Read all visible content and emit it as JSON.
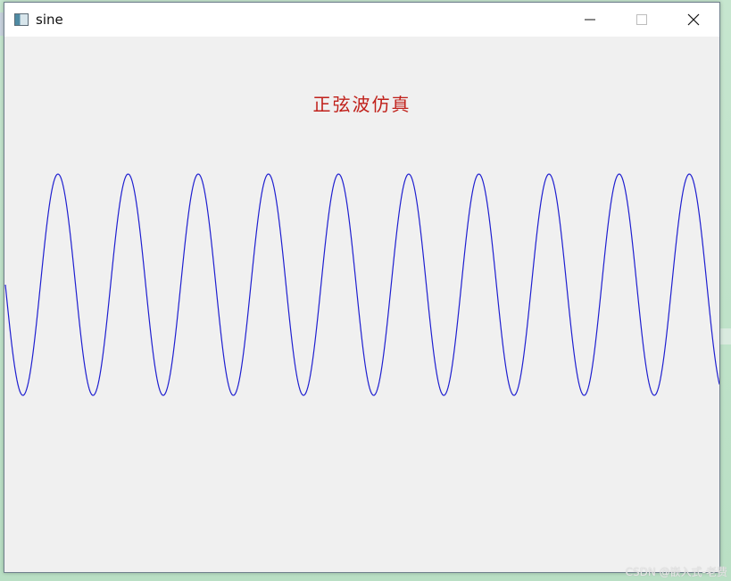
{
  "window": {
    "title": "sine",
    "icon": "app-window-icon",
    "controls": [
      "minimize-icon",
      "maximize-icon",
      "close-icon"
    ]
  },
  "content": {
    "heading": "正弦波仿真",
    "heading_color": "#c0201a"
  },
  "chart_data": {
    "type": "line",
    "series": [
      {
        "function": "sine",
        "cycles_visible": 10,
        "phase_start": "zero crossing, descending",
        "color": "#1f1fd0"
      }
    ]
  },
  "watermark": "CSDN @嵌入式-老费"
}
